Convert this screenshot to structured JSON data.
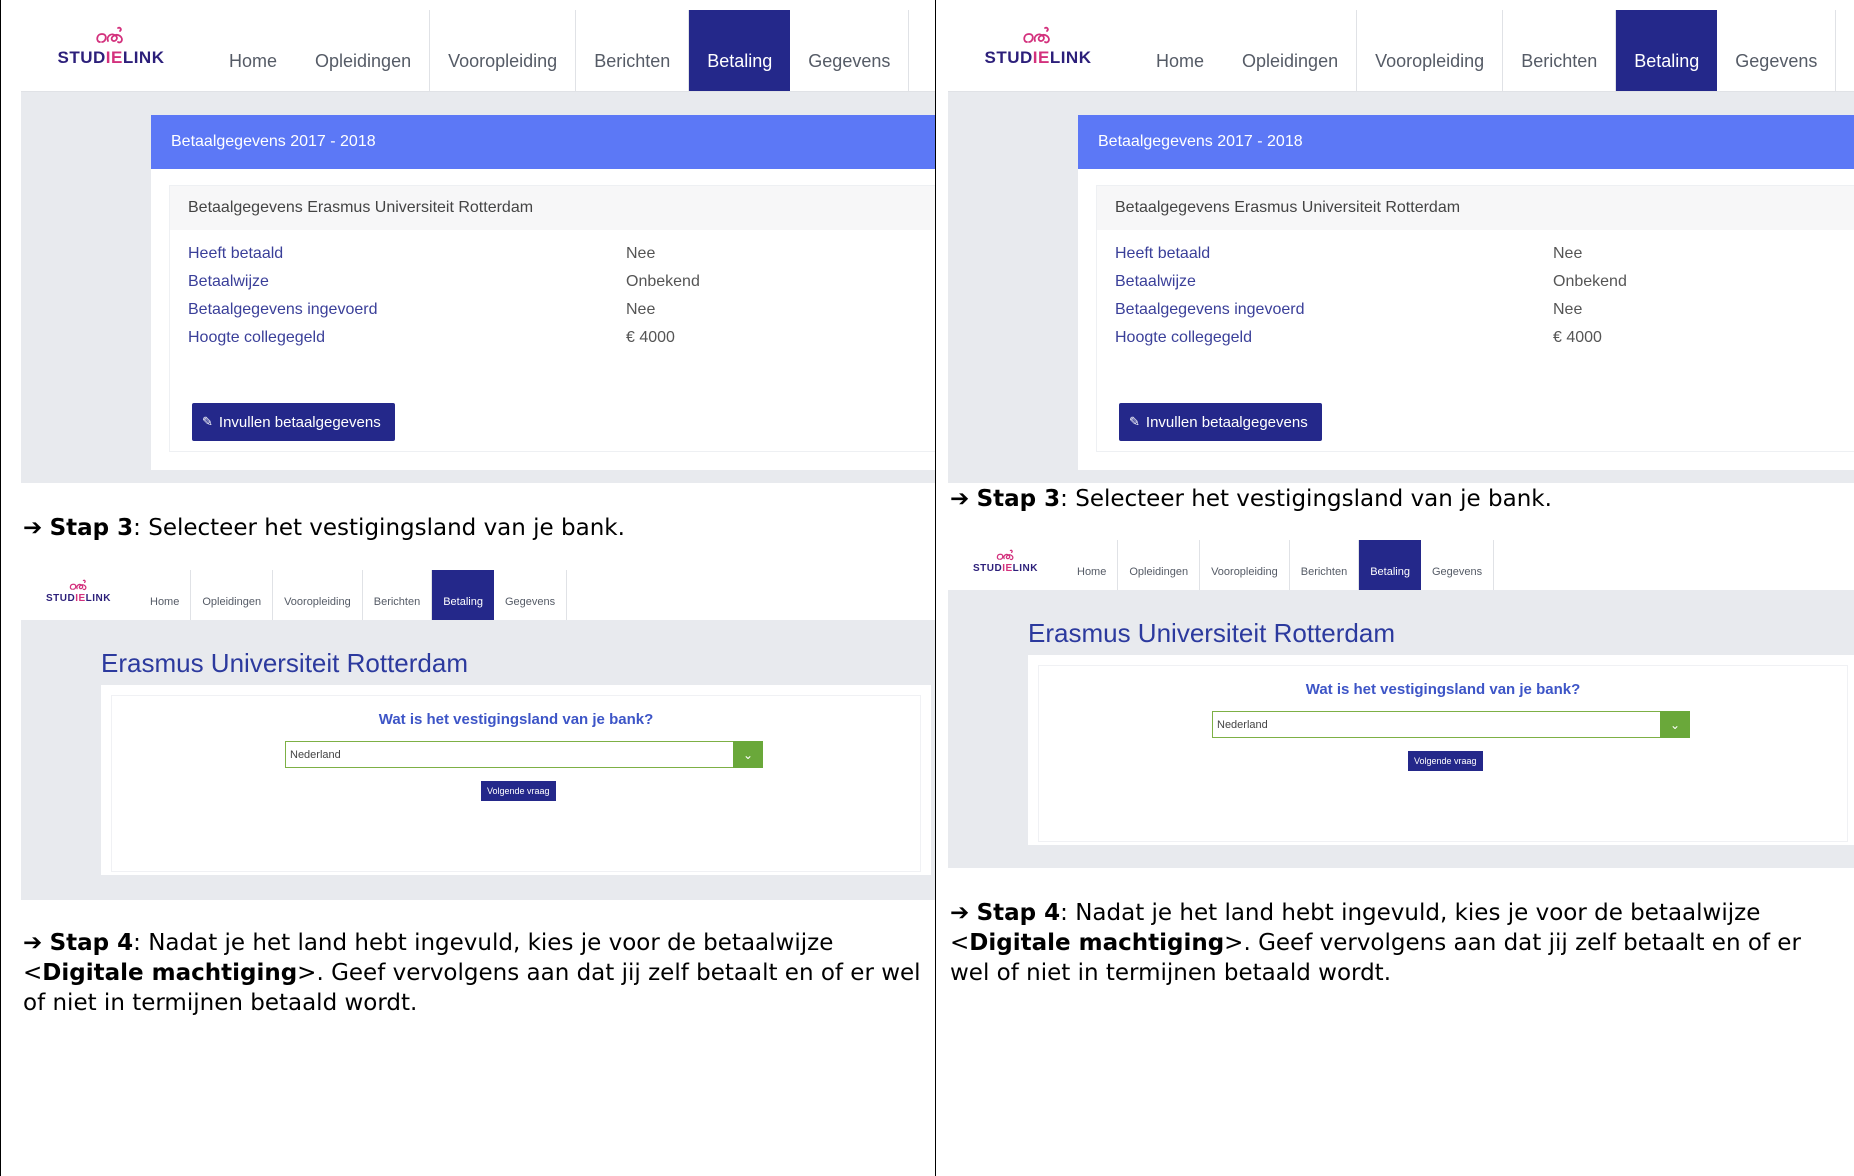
{
  "studielink": {
    "logo_text": "STUDIELINK",
    "nav": [
      "Home",
      "Opleidingen",
      "Vooropleiding",
      "Berichten",
      "Betaling",
      "Gegevens"
    ],
    "active_tab": "Betaling"
  },
  "payment_card": {
    "header": "Betaalgegevens 2017 - 2018",
    "subheader": "Betaalgegevens Erasmus Universiteit Rotterdam",
    "rows": [
      {
        "label": "Heeft betaald",
        "value": "Nee"
      },
      {
        "label": "Betaalwijze",
        "value": "Onbekend"
      },
      {
        "label": "Betaalgegevens ingevoerd",
        "value": "Nee"
      },
      {
        "label": "Hoogte collegegeld",
        "value": "€ 4000"
      }
    ],
    "button": "Invullen betaalgegevens"
  },
  "step3": {
    "label": "Stap 3",
    "text": ": Selecteer het vestigingsland van je bank."
  },
  "country_form": {
    "university": "Erasmus Universiteit Rotterdam",
    "question": "Wat is het vestigingsland van je bank?",
    "selected": "Nederland",
    "button": "Volgende vraag"
  },
  "step4": {
    "label": "Stap 4",
    "text_a": ": Nadat je het land hebt ingevuld, kies je voor de betaalwijze <",
    "bold": "Digitale machtiging",
    "text_b": ">. Geef vervolgens aan dat jij zelf betaalt en of er wel of niet in termijnen betaald wordt."
  },
  "colors": {
    "nav_active": "#24288a",
    "card_header": "#5c78f6",
    "select_accent": "#6aa83a"
  }
}
